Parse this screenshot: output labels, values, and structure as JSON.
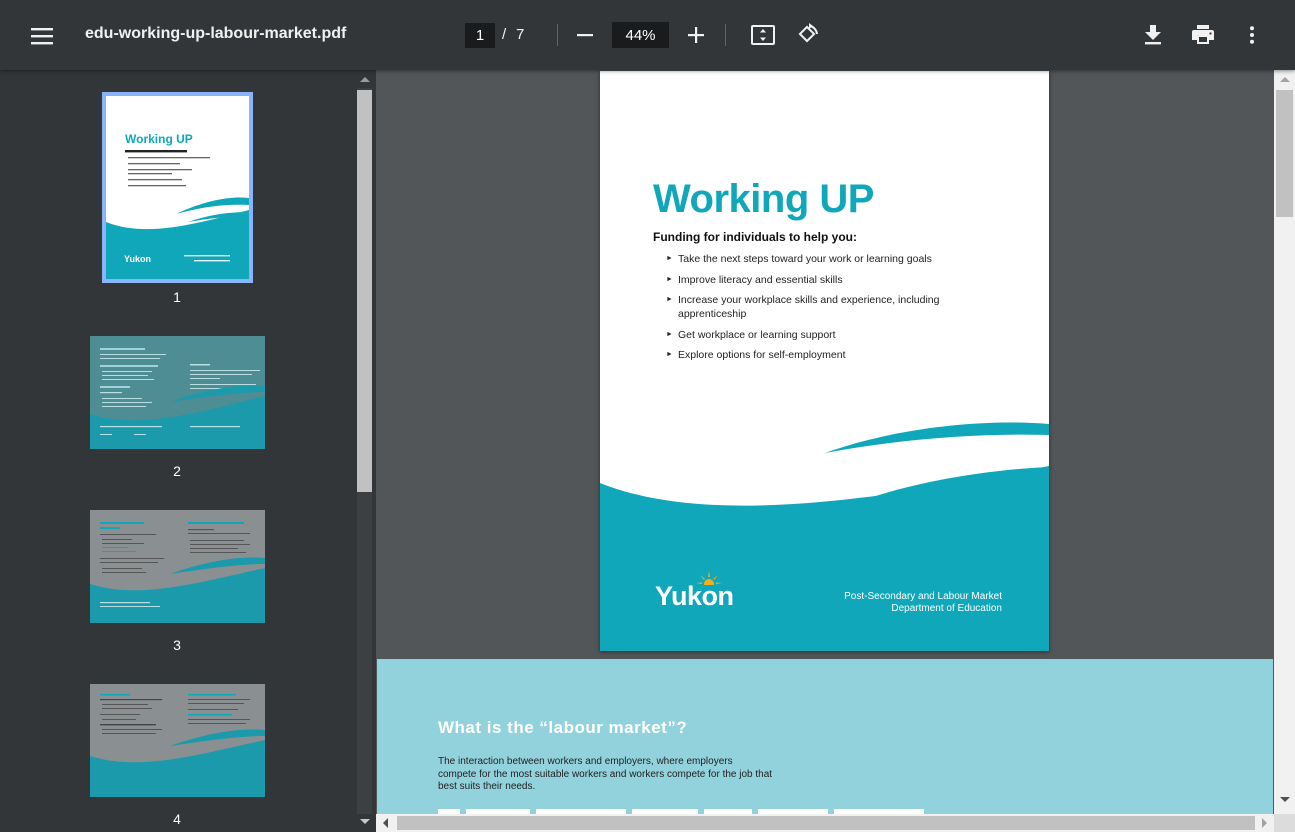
{
  "toolbar": {
    "title": "edu-working-up-labour-market.pdf",
    "current_page": "1",
    "page_separator": "/",
    "total_pages": "7",
    "zoom": "44%",
    "icons": [
      "menu-icon",
      "minus-icon",
      "plus-icon",
      "fit-page-icon",
      "rotate-icon",
      "download-icon",
      "print-icon",
      "more-vert-icon"
    ]
  },
  "sidebar": {
    "thumbnails": [
      {
        "label": "1",
        "selected": true
      },
      {
        "label": "2",
        "selected": false
      },
      {
        "label": "3",
        "selected": false
      },
      {
        "label": "4",
        "selected": false
      }
    ]
  },
  "page1": {
    "title": "Working UP",
    "subtitle": "Funding for individuals to help you:",
    "items": [
      "Take the next steps toward your work or learning goals",
      "Improve literacy and essential skills",
      "Increase your workplace skills and experience, including apprenticeship",
      "Get workplace or learning support",
      "Explore options for self-employment"
    ],
    "logo_text": "Yukon",
    "dept_line1": "Post-Secondary and Labour Market",
    "dept_line2": "Department of Education"
  },
  "page2": {
    "heading": "What is the “labour market”?",
    "body": "The interaction between workers and employers, where employers compete for the most suitable workers and workers compete for the job that best suits their needs."
  },
  "colors": {
    "toolbar_bg": "#323639",
    "viewer_bg": "#525659",
    "accent_teal": "#0fa7b9",
    "page2_bg": "#92d2dd",
    "selected_thumb_border": "#8ab4f8"
  }
}
